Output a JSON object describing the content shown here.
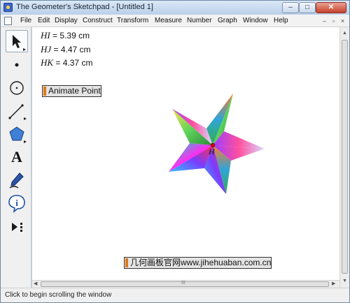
{
  "window": {
    "title": "The Geometer's Sketchpad - [Untitled 1]",
    "controls": {
      "minimize": "–",
      "maximize": "□",
      "close": "✕"
    }
  },
  "menu": {
    "items": [
      "File",
      "Edit",
      "Display",
      "Construct",
      "Transform",
      "Measure",
      "Number",
      "Graph",
      "Window",
      "Help"
    ],
    "mdi": {
      "minimize": "–",
      "restore": "▫",
      "close": "×"
    }
  },
  "toolbox": {
    "tools": [
      {
        "name": "selection-arrow-tool",
        "icon": "arrow-pointer-icon"
      },
      {
        "name": "point-tool",
        "icon": "point-icon"
      },
      {
        "name": "compass-tool",
        "icon": "circle-icon"
      },
      {
        "name": "straightedge-tool",
        "icon": "segment-icon"
      },
      {
        "name": "polygon-tool",
        "icon": "polygon-icon"
      },
      {
        "name": "text-tool",
        "icon": "text-icon",
        "glyph": "A"
      },
      {
        "name": "marker-tool",
        "icon": "marker-pen-icon"
      },
      {
        "name": "information-tool",
        "icon": "info-icon",
        "glyph": "i"
      },
      {
        "name": "custom-tool",
        "icon": "custom-tool-icon"
      }
    ]
  },
  "measurements": [
    {
      "label": "HI",
      "equals": " = ",
      "value": "5.39",
      "unit": " cm"
    },
    {
      "label": "HJ",
      "equals": " = ",
      "value": "4.47",
      "unit": " cm"
    },
    {
      "label": "HK",
      "equals": " = ",
      "value": "4.37",
      "unit": " cm"
    }
  ],
  "buttons": {
    "animate": "Animate Point",
    "website": "几何画板官网www.jihehuaban.com.cn"
  },
  "star": {
    "center_label": "H"
  },
  "scroll": {
    "grip": "III"
  },
  "status": "Click to begin scrolling the window",
  "colors": {
    "action_marker": "#e07818",
    "title_gradient_top": "#dbe8f6",
    "close_red": "#c7412c"
  }
}
